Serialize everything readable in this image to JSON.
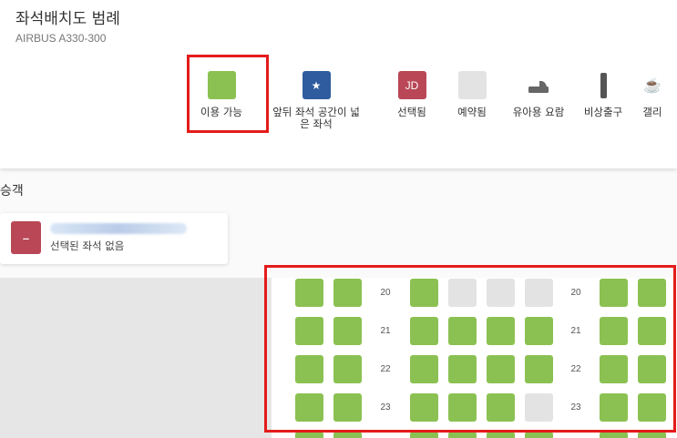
{
  "legend": {
    "title": "좌석배치도 범례",
    "aircraft": "AIRBUS A330-300",
    "items": [
      {
        "name": "available",
        "label": "이용 가능",
        "color": "#8bc152",
        "glyph": ""
      },
      {
        "name": "extra-legroom",
        "label": "앞뒤 좌석 공간이 넓은 좌석",
        "color": "#2f5c9e",
        "glyph": "★"
      },
      {
        "name": "selected",
        "label": "선택됨",
        "color": "#b94756",
        "glyph": "JD"
      },
      {
        "name": "reserved",
        "label": "예약됨",
        "color": "#e3e3e3",
        "glyph": ""
      },
      {
        "name": "bassinet",
        "label": "유아용 요람",
        "color": "transparent",
        "glyph": ""
      },
      {
        "name": "exit",
        "label": "비상출구",
        "color": "transparent",
        "glyph": ""
      },
      {
        "name": "galley",
        "label": "갤리",
        "color": "transparent",
        "glyph": "☕"
      }
    ]
  },
  "passenger": {
    "heading": "승객",
    "badge": "–",
    "seat_status": "선택된 좌석 없음"
  },
  "seatmap": {
    "colors": {
      "available": "#8bc152",
      "reserved": "#e3e3e3"
    },
    "rows": [
      {
        "number": "20",
        "seats": [
          "available",
          "available",
          "available",
          "reserved",
          "reserved",
          "reserved",
          "available",
          "available"
        ]
      },
      {
        "number": "21",
        "seats": [
          "available",
          "available",
          "available",
          "available",
          "available",
          "available",
          "available",
          "available"
        ]
      },
      {
        "number": "22",
        "seats": [
          "available",
          "available",
          "available",
          "available",
          "available",
          "available",
          "available",
          "available"
        ]
      },
      {
        "number": "23",
        "seats": [
          "available",
          "available",
          "available",
          "available",
          "available",
          "reserved",
          "available",
          "available"
        ]
      }
    ]
  }
}
